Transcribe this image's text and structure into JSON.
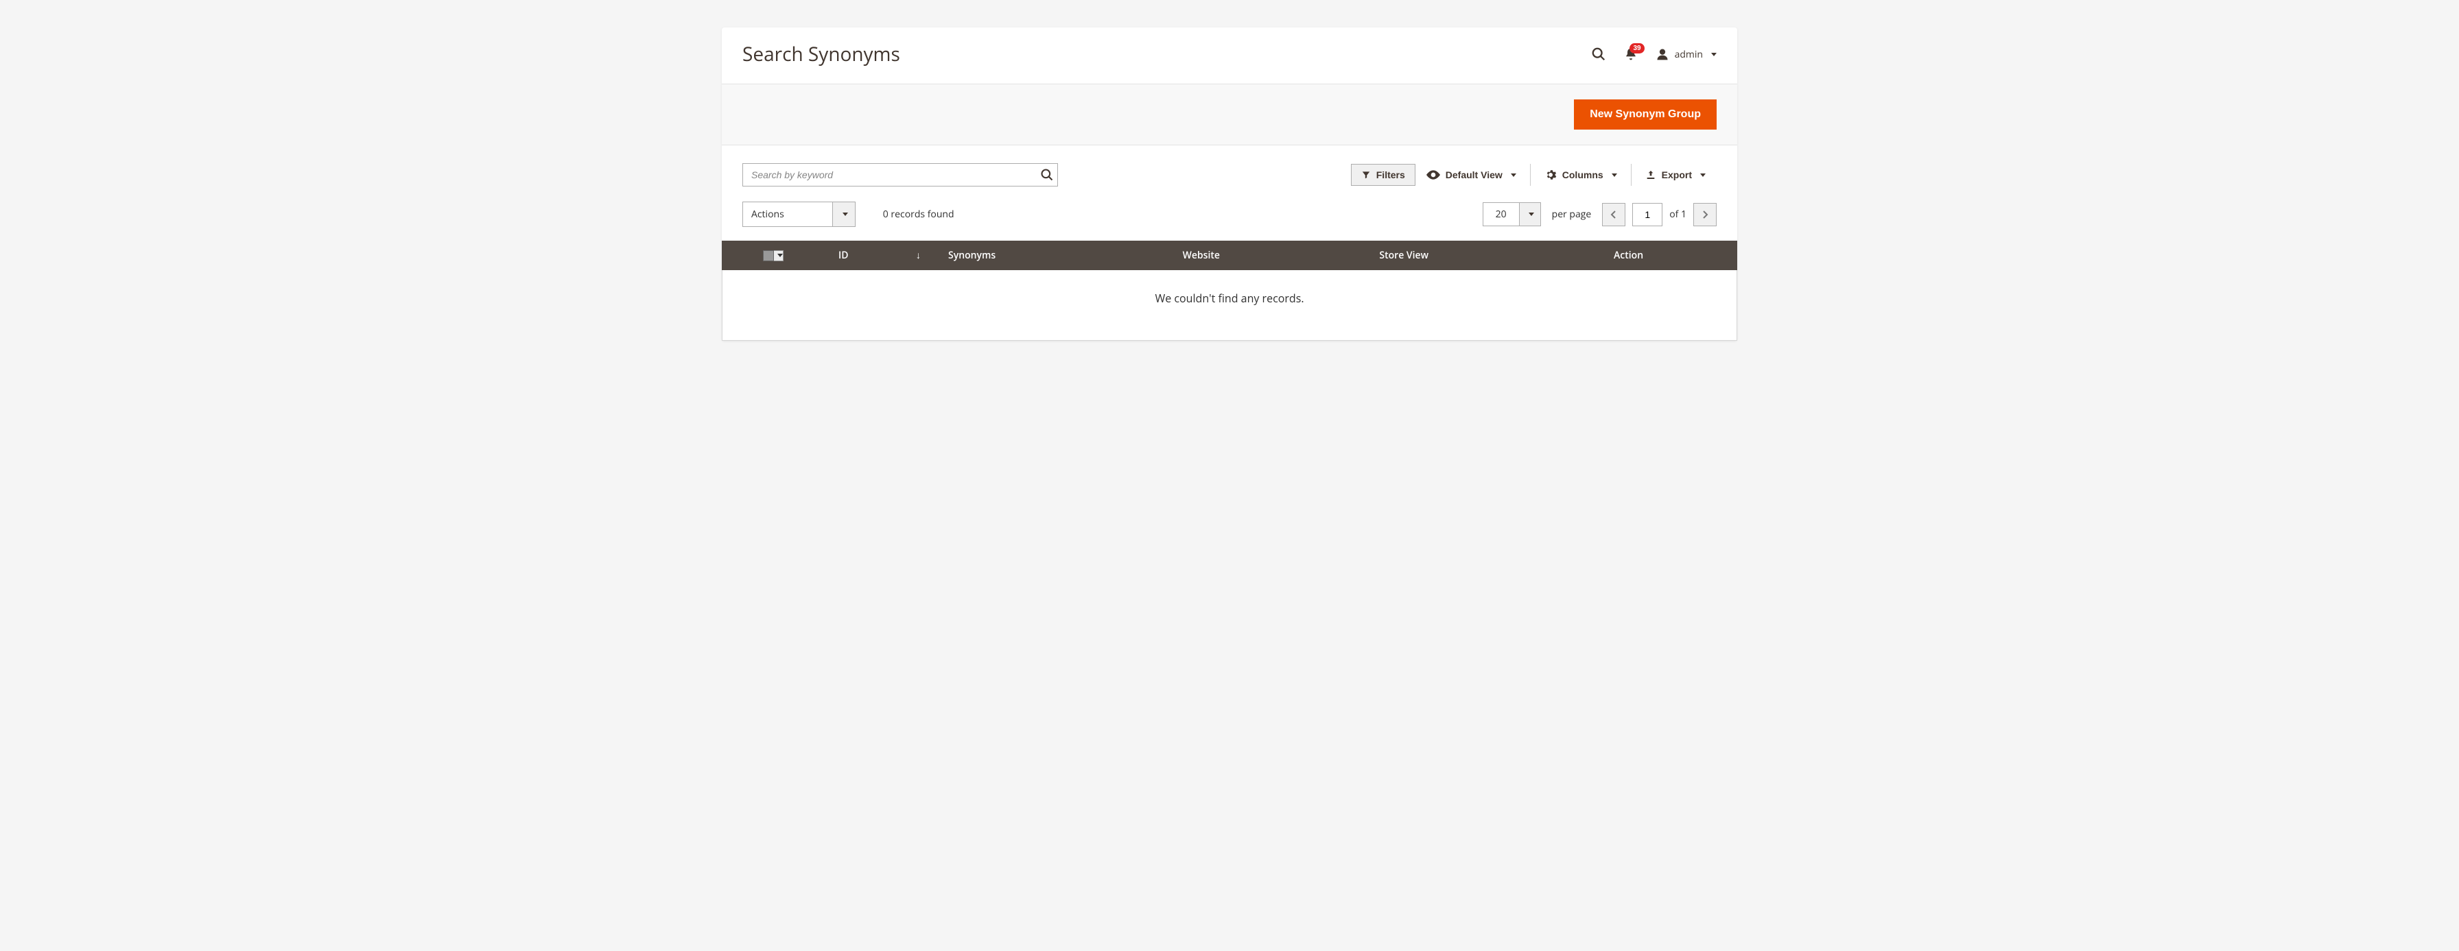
{
  "header": {
    "title": "Search Synonyms",
    "notification_count": "39",
    "user_label": "admin"
  },
  "action_bar": {
    "primary_label": "New Synonym Group"
  },
  "toolbar": {
    "search_placeholder": "Search by keyword",
    "filters_label": "Filters",
    "view_label": "Default View",
    "columns_label": "Columns",
    "export_label": "Export"
  },
  "sub_toolbar": {
    "actions_label": "Actions",
    "records_found": "0 records found",
    "page_size": "20",
    "per_page_label": "per page",
    "current_page": "1",
    "total_pages_label": "of 1"
  },
  "grid": {
    "columns": {
      "id": "ID",
      "synonyms": "Synonyms",
      "website": "Website",
      "store_view": "Store View",
      "action": "Action"
    },
    "empty_message": "We couldn't find any records."
  }
}
